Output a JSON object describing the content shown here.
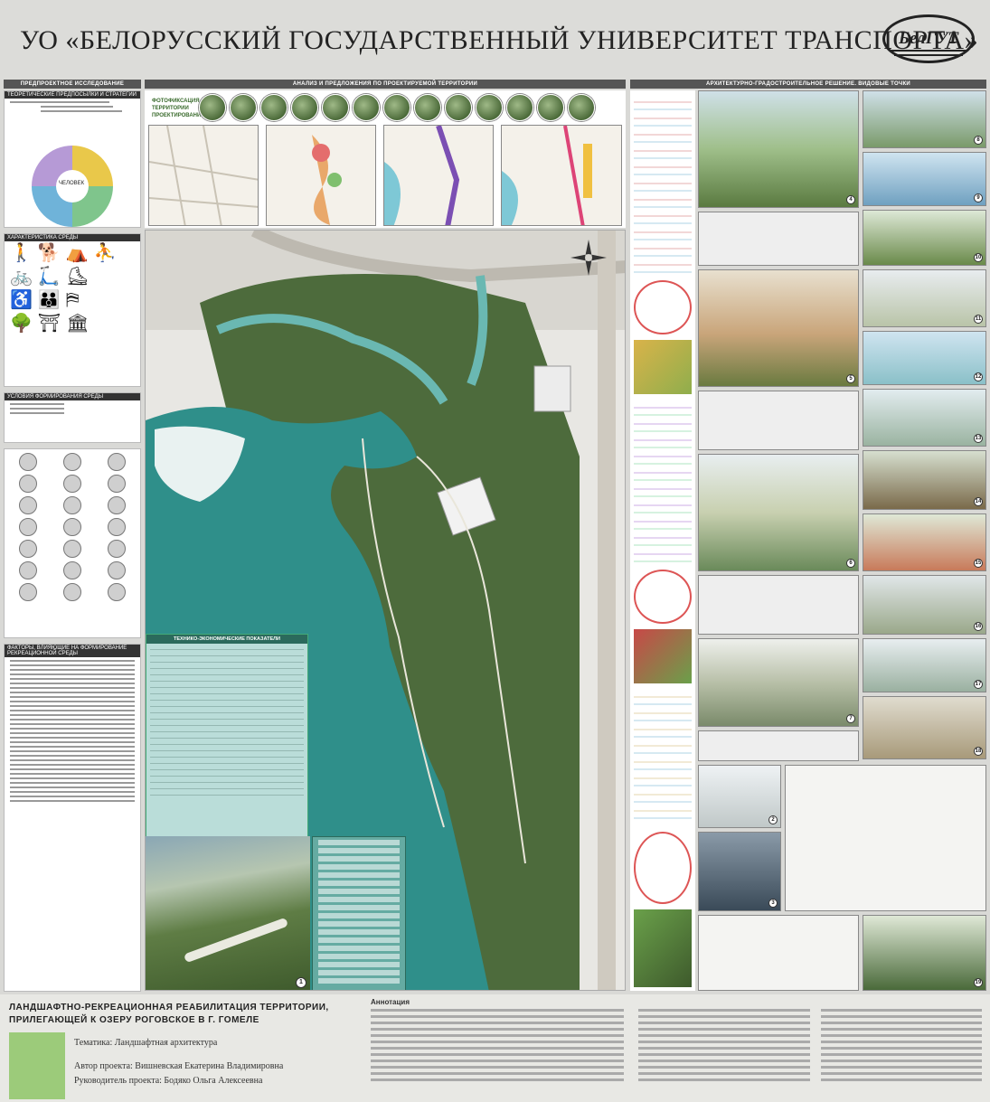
{
  "header": {
    "title": "УО «БЕЛОРУССКИЙ ГОСУДАРСТВЕННЫЙ УНИВЕРСИТЕТ ТРАНСПОРТА»",
    "logo_text": "БелГУТ"
  },
  "sections": {
    "pre_project": "ПРЕДПРОЕКТНОЕ ИССЛЕДОВАНИЕ",
    "analysis": "АНАЛИЗ И ПРЕДЛОЖЕНИЯ ПО ПРОЕКТИРУЕМОЙ ТЕРРИТОРИИ",
    "architecture": "АРХИТЕКТУРНО-ГРАДОСТРОИТЕЛЬНОЕ РЕШЕНИЕ. ВИДОВЫЕ ТОЧКИ"
  },
  "left": {
    "theory_title": "ТЕОРЕТИЧЕСКИЕ ПРЕДПОСЫЛКИ И СТРАТЕГИИ",
    "donut_center": "ЧЕЛОВЕК",
    "characteristics_title": "ХАРАКТЕРИСТИКА СРЕДЫ",
    "conditions_title": "УСЛОВИЯ ФОРМИРОВАНИЯ СРЕДЫ",
    "factors_title": "ФАКТОРЫ, ВЛИЯЮЩИЕ НА ФОРМИРОВАНИЕ РЕКРЕАЦИОННОЙ СРЕДЫ"
  },
  "topband": {
    "photo_label": "ФОТОФИКСАЦИЯ ТЕРРИТОРИИ ПРОЕКТИРОВАНИЯ"
  },
  "plan": {
    "teo_title": "ТЕХНИКО-ЭКОНОМИЧЕСКИЕ ПОКАЗАТЕЛИ",
    "photo_num": "1"
  },
  "views": [
    {
      "num": "4"
    },
    {
      "num": "8"
    },
    {
      "num": "9"
    },
    {
      "num": "10"
    },
    {
      "num": "5"
    },
    {
      "num": "11"
    },
    {
      "num": "12"
    },
    {
      "num": "13"
    },
    {
      "num": "6"
    },
    {
      "num": "14"
    },
    {
      "num": "15"
    },
    {
      "num": "16"
    },
    {
      "num": "7"
    },
    {
      "num": "17"
    },
    {
      "num": "18"
    },
    {
      "num": "2"
    },
    {
      "num": "3"
    },
    {
      "num": "19"
    }
  ],
  "footer": {
    "title": "ЛАНДШАФТНО-РЕКРЕАЦИОННАЯ РЕАБИЛИТАЦИЯ ТЕРРИТОРИИ, ПРИЛЕГАЮЩЕЙ К ОЗЕРУ РОГОВСКОЕ В Г. ГОМЕЛЕ",
    "topic": "Тематика: Ландшафтная архитектура",
    "author": "Автор проекта: Вишневская Екатерина Владимировна",
    "supervisor": "Руководитель проекта: Бодяко Ольга Алексеевна",
    "annotation_title": "Аннотация"
  },
  "colors": {
    "water": "#2f8f8a",
    "vegetation": "#4d6b3c",
    "accent_green": "#9ccb7a"
  }
}
